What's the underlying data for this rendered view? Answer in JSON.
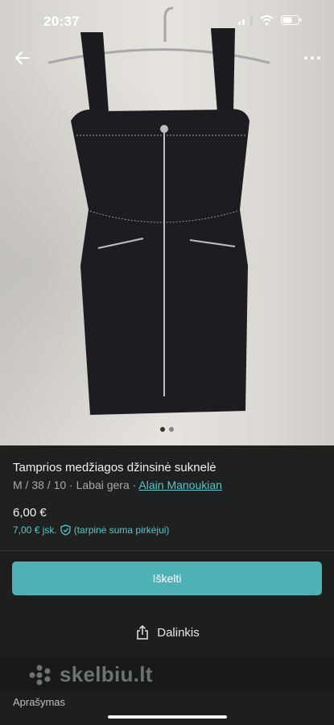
{
  "status_bar": {
    "time": "20:37"
  },
  "nav": {
    "back_icon": "arrow-left-icon",
    "more_icon": "more-horizontal-icon"
  },
  "gallery": {
    "image_count": 2,
    "active_index": 0
  },
  "listing": {
    "title": "Tamprios medžiagos džinsinė suknelė",
    "size_condition": "M / 38 / 10 · Labai gera · ",
    "brand": "Alain Manoukian",
    "price": "6,00 €",
    "buyer_price": "7,00 € jsk.",
    "buyer_note": "(tarpinė suma pirkėjui)"
  },
  "actions": {
    "bump_label": "Iškelti",
    "share_label": "Dalinkis"
  },
  "banner": {
    "logo_text": "skelbiu.lt"
  },
  "description_heading": "Aprašymas",
  "colors": {
    "accent": "#4fb0b5",
    "link": "#59c3c8",
    "background": "#1f2121"
  }
}
